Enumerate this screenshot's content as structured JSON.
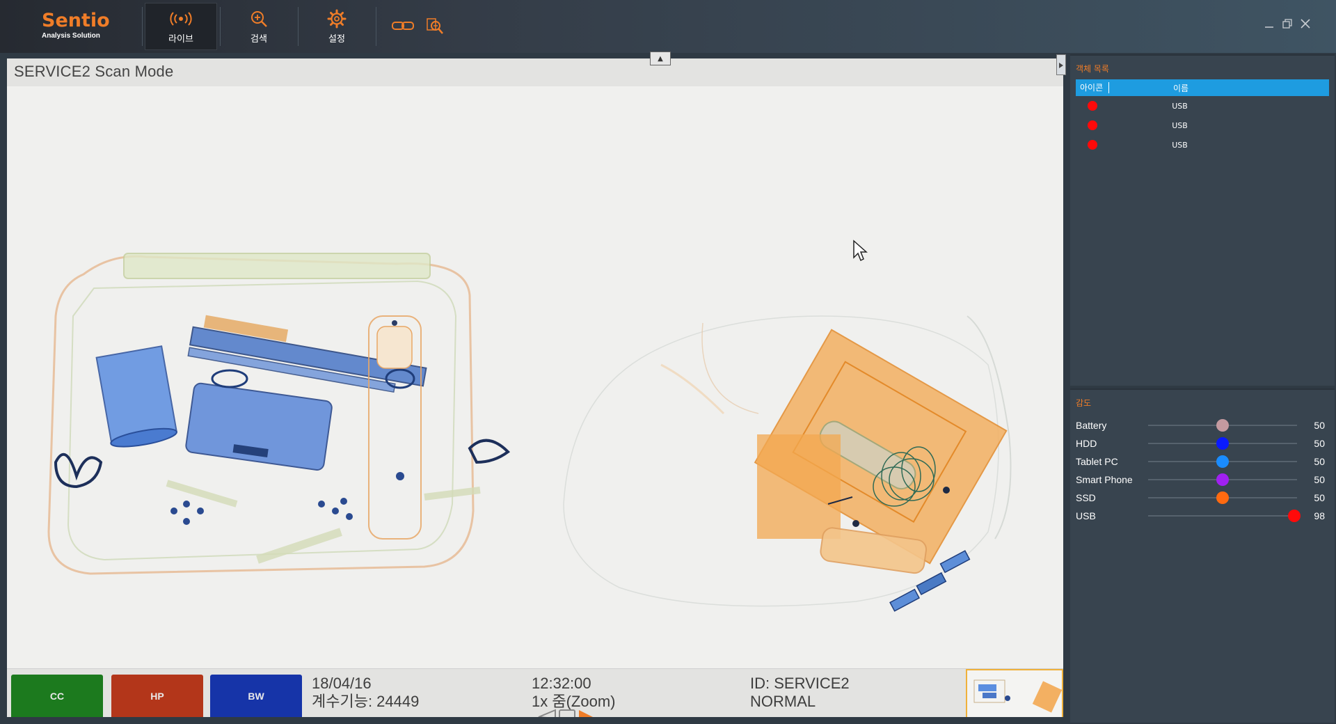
{
  "app": {
    "brand_name": "Sentio",
    "brand_sub": "Analysis Solution",
    "accent": "#f07d28"
  },
  "nav": {
    "live_label": "라이브",
    "search_label": "검색",
    "settings_label": "설정"
  },
  "toolbar_icons": [
    "link-icon",
    "inspect-icon"
  ],
  "window_controls": [
    "minimize-icon",
    "restore-icon",
    "close-icon"
  ],
  "viewer": {
    "title": "SERVICE2 Scan Mode",
    "modes": [
      {
        "label": "CC",
        "color": "#1c7a1e"
      },
      {
        "label": "HP",
        "color": "#b3361a"
      },
      {
        "label": "BW",
        "color": "#1634a8"
      }
    ],
    "date": "18/04/16",
    "counter": "계수기능: 24449",
    "time": "12:32:00",
    "zoom": "1x 줌(Zoom)",
    "id": "ID: SERVICE2",
    "status": "NORMAL"
  },
  "object_list": {
    "title": "객체 목록",
    "col_icon": "아이콘",
    "col_name": "이름",
    "items": [
      {
        "name": "USB",
        "color": "#ff0a0a"
      },
      {
        "name": "USB",
        "color": "#ff0a0a"
      },
      {
        "name": "USB",
        "color": "#ff0a0a"
      }
    ]
  },
  "sensitivity": {
    "title": "감도",
    "items": [
      {
        "label": "Battery",
        "value": 50,
        "display": "50",
        "color": "#c49aa0"
      },
      {
        "label": "HDD",
        "value": 50,
        "display": "50",
        "color": "#0a1aff"
      },
      {
        "label": "Tablet PC",
        "value": 50,
        "display": "50",
        "color": "#1a8cff"
      },
      {
        "label": "Smart Phone",
        "value": 50,
        "display": "50",
        "color": "#a020f0"
      },
      {
        "label": "SSD",
        "value": 50,
        "display": "50",
        "color": "#ff6a10"
      },
      {
        "label": "USB",
        "value": 98,
        "display": "98",
        "color": "#ff0a0a"
      }
    ]
  }
}
